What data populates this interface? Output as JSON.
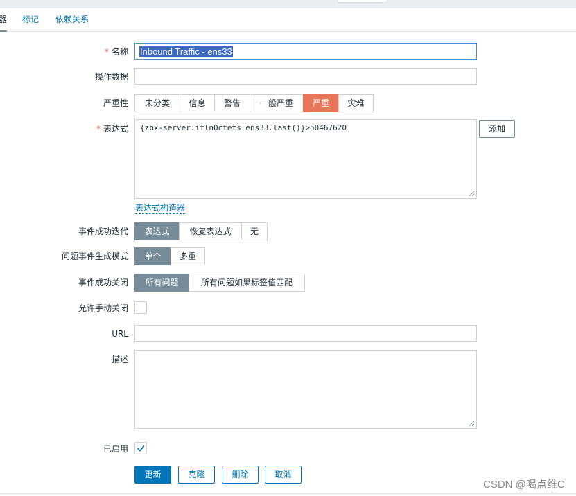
{
  "tabs": [
    {
      "label": "器"
    },
    {
      "label": "标记"
    },
    {
      "label": "依赖关系"
    }
  ],
  "form": {
    "name": {
      "required_mark": "*",
      "label": "名称",
      "value": "Inbound Traffic - ens33"
    },
    "opdata": {
      "label": "操作数据",
      "value": ""
    },
    "severity": {
      "label": "严重性",
      "options": [
        "未分类",
        "信息",
        "警告",
        "一般严重",
        "严重",
        "灾难"
      ],
      "selected": "严重",
      "selected_color": "#e97659"
    },
    "expression": {
      "required_mark": "*",
      "label": "表达式",
      "value": "{zbx-server:iflnOctets_ens33.last()}>50467620",
      "add_label": "添加",
      "constructor_link": "表达式构造器"
    },
    "ok_event_generation": {
      "label": "事件成功迭代",
      "options": [
        "表达式",
        "恢复表达式",
        "无"
      ],
      "selected": "表达式"
    },
    "problem_mode": {
      "label": "问题事件生成模式",
      "options": [
        "单个",
        "多重"
      ],
      "selected": "单个"
    },
    "ok_event_closes": {
      "label": "事件成功关闭",
      "options": [
        "所有问题",
        "所有问题如果标签值匹配"
      ],
      "selected": "所有问题"
    },
    "manual_close": {
      "label": "允许手动关闭",
      "checked": false
    },
    "url": {
      "label": "URL",
      "value": ""
    },
    "description": {
      "label": "描述",
      "value": ""
    },
    "enabled": {
      "label": "已启用",
      "checked": true
    }
  },
  "buttons": {
    "update": "更新",
    "clone": "克隆",
    "delete": "删除",
    "cancel": "取消"
  },
  "watermark": "CSDN @喝点维C",
  "colors": {
    "accent": "#0275b8",
    "selected_segment": "#768d99",
    "high_severity": "#e97659",
    "selection_highlight": "#3c67c2"
  }
}
